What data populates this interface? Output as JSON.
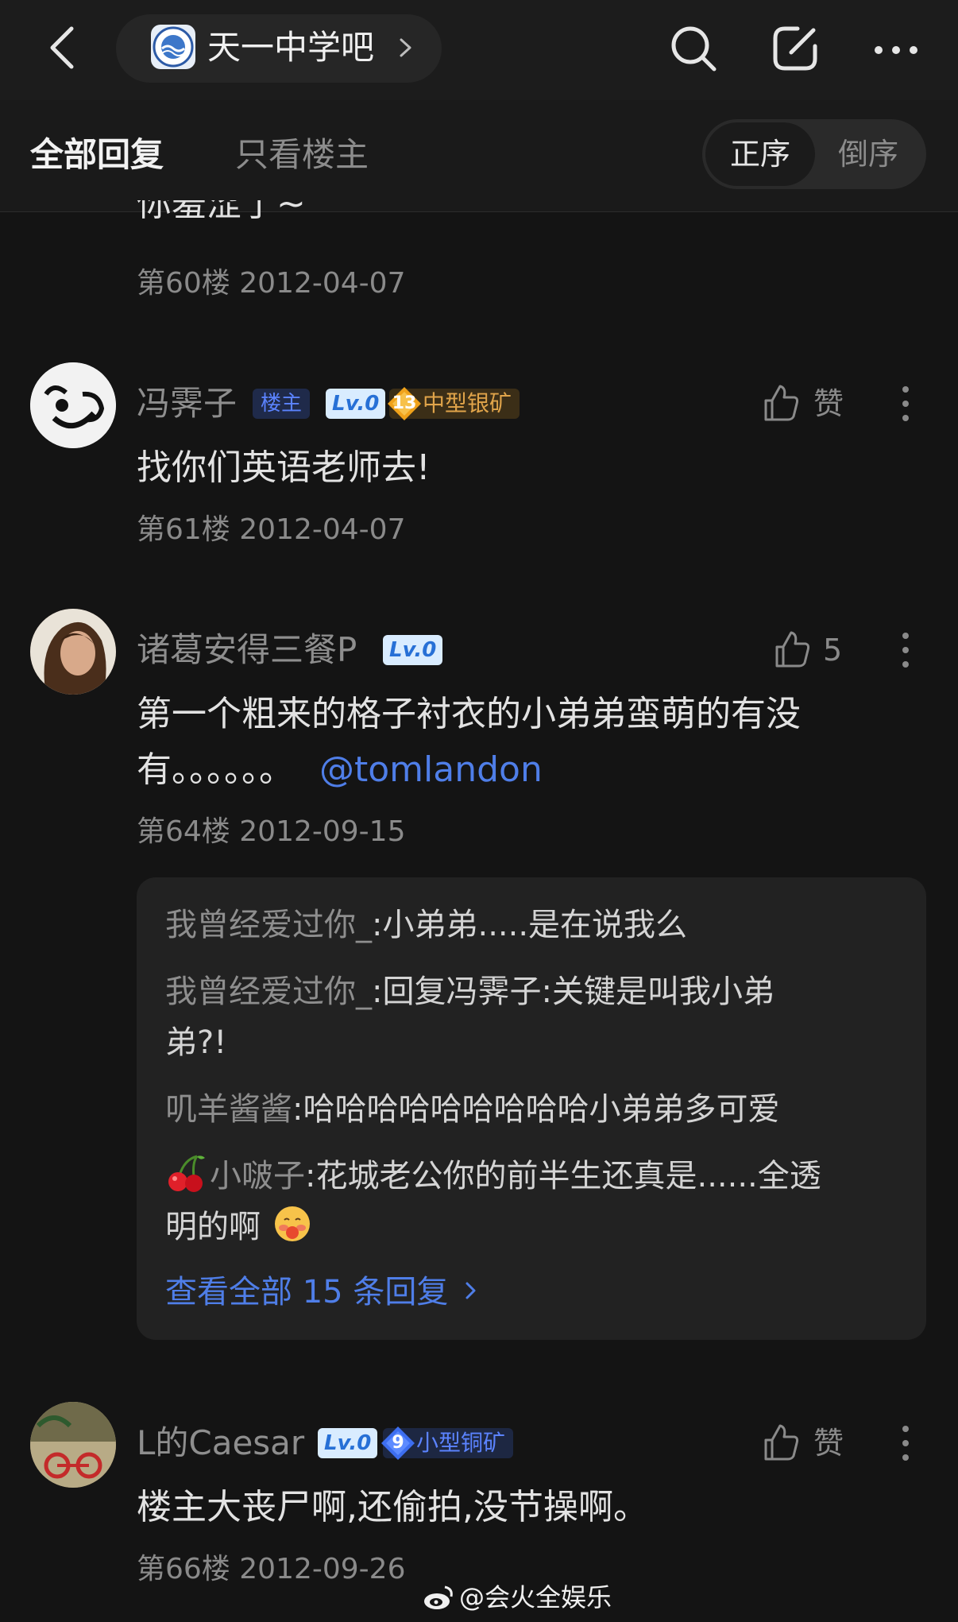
{
  "header": {
    "forum_name": "天一中学吧"
  },
  "tabs": {
    "all_replies": "全部回复",
    "op_only": "只看楼主",
    "order_asc": "正序",
    "order_desc": "倒序"
  },
  "posts": [
    {
      "partial_text": "你羞涩了~",
      "floor": "第60楼",
      "date": "2012-04-07"
    },
    {
      "username": "冯霁子",
      "op_badge": "楼主",
      "level": "Lv.0",
      "mine_level": "13",
      "mine_label": "中型银矿",
      "like_label": "赞",
      "text": "找你们英语老师去!",
      "floor": "第61楼",
      "date": "2012-04-07"
    },
    {
      "username": "诸葛安得三餐P",
      "level": "Lv.0",
      "like_label": "5",
      "text_line1": "第一个粗来的格子衬衣的小弟弟蛮萌的有没",
      "text_line2": "有。。。。。。",
      "mention": "@tomlandon",
      "floor": "第64楼",
      "date": "2012-09-15",
      "replies": [
        {
          "who": "我曾经爱过你_",
          "text": ":小弟弟.....是在说我么"
        },
        {
          "who": "我曾经爱过你_",
          "text": ":回复冯霁子:关键是叫我小弟",
          "text2": "弟?!"
        },
        {
          "who": "叽羊酱酱",
          "text": ":哈哈哈哈哈哈哈哈哈小弟弟多可爱"
        },
        {
          "who": "小啵子",
          "text": ":花城老公你的前半生还真是......全透",
          "text2": "明的啊"
        }
      ],
      "view_all": "查看全部 15 条回复"
    },
    {
      "username": "L的Caesar",
      "level": "Lv.0",
      "mine_level": "9",
      "mine_label": "小型铜矿",
      "like_label": "赞",
      "text": "楼主大丧尸啊,还偷拍,没节操啊。",
      "floor": "第66楼",
      "date": "2012-09-26"
    }
  ],
  "watermark": "@会火全娱乐",
  "colors": {
    "background": "#141414",
    "link": "#4f7ee8",
    "silver_mine": "#e0a44a",
    "copper_mine": "#5b83ff"
  }
}
